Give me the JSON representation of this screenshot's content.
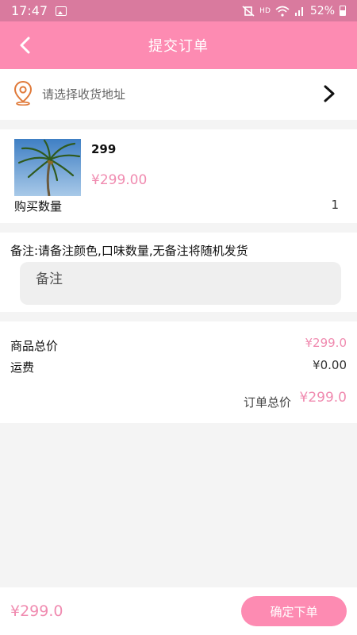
{
  "status_bar": {
    "time": "17:47",
    "signal_text": "HD",
    "battery": "52%",
    "icons": [
      "image-icon",
      "mute-vibrate-icon",
      "wifi-icon",
      "cell-signal-icon",
      "battery-icon"
    ]
  },
  "header": {
    "title": "提交订单",
    "back_icon": "chevron-left-icon"
  },
  "address": {
    "placeholder": "请选择收货地址",
    "icon": "location-pin-icon",
    "arrow_icon": "chevron-right-icon"
  },
  "product": {
    "name": "299",
    "price": "¥299.00",
    "quantity_label": "购买数量",
    "quantity": "1"
  },
  "remark": {
    "label": "备注:请备注颜色,口味数量,无备注将随机发货",
    "placeholder": "备注"
  },
  "summary": {
    "goods_total_label": "商品总价",
    "goods_total_value": "¥299.0",
    "shipping_label": "运费",
    "shipping_value": "¥0.00",
    "order_total_label": "订单总价",
    "order_total_value": "¥299.0"
  },
  "bottom_bar": {
    "amount": "¥299.0",
    "submit_label": "确定下单"
  },
  "colors": {
    "accent": "#fd8bb2",
    "price": "#f08bb0",
    "status_bar": "#d97a9e",
    "pin": "#e07a3a"
  }
}
